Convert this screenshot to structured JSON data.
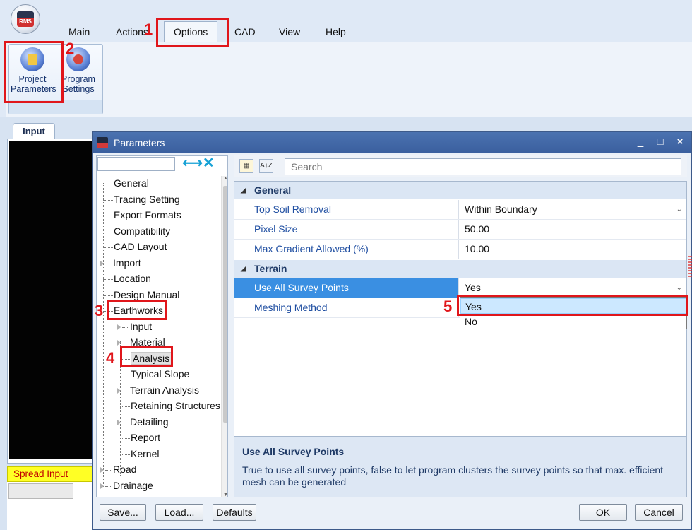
{
  "ribbon": {
    "tabs": [
      "Main",
      "Actions",
      "Options",
      "CAD",
      "View",
      "Help"
    ],
    "active_tab": "Options",
    "buttons": [
      {
        "label": "Project\nParameters",
        "line1": "Project",
        "line2": "Parameters",
        "icon": "project-parameters-icon"
      },
      {
        "label": "Program\nSettings",
        "line1": "Program",
        "line2": "Settings",
        "icon": "program-settings-icon"
      }
    ]
  },
  "workspace": {
    "input_tab": "Input",
    "spread_input": "Spread Input"
  },
  "dialog": {
    "title": "Parameters",
    "window_controls": [
      "_",
      "□",
      "×"
    ],
    "tree": {
      "clear_icon": "⟷✕",
      "items": [
        {
          "label": "General",
          "level": 0
        },
        {
          "label": "Tracing Setting",
          "level": 0
        },
        {
          "label": "Export Formats",
          "level": 0
        },
        {
          "label": "Compatibility",
          "level": 0
        },
        {
          "label": "CAD Layout",
          "level": 0
        },
        {
          "label": "Import",
          "level": 0,
          "expandable": true
        },
        {
          "label": "Location",
          "level": 0
        },
        {
          "label": "Design Manual",
          "level": 0
        },
        {
          "label": "Earthworks",
          "level": 0,
          "expanded": true
        },
        {
          "label": "Input",
          "level": 1,
          "expandable": true
        },
        {
          "label": "Material",
          "level": 1,
          "expandable": true
        },
        {
          "label": "Analysis",
          "level": 1,
          "selected": true
        },
        {
          "label": "Typical Slope",
          "level": 1
        },
        {
          "label": "Terrain Analysis",
          "level": 1,
          "expandable": true
        },
        {
          "label": "Retaining Structures",
          "level": 1
        },
        {
          "label": "Detailing",
          "level": 1,
          "expandable": true
        },
        {
          "label": "Report",
          "level": 1
        },
        {
          "label": "Kernel",
          "level": 1
        },
        {
          "label": "Road",
          "level": 0,
          "expandable": true
        },
        {
          "label": "Drainage",
          "level": 0,
          "expandable": true
        }
      ]
    },
    "toolbar": {
      "categorized_icon": "categorized-view-icon",
      "alpha_icon": "alphabetical-sort-icon",
      "alpha_label": "A↓Z",
      "search_placeholder": "Search"
    },
    "grid": {
      "categories": [
        {
          "name": "General",
          "properties": [
            {
              "name": "Top Soil Removal",
              "value": "Within Boundary",
              "dropdown": true
            },
            {
              "name": "Pixel Size",
              "value": "50.00"
            },
            {
              "name": "Max Gradient Allowed (%)",
              "value": "10.00"
            }
          ]
        },
        {
          "name": "Terrain",
          "properties": [
            {
              "name": "Use All Survey Points",
              "value": "Yes",
              "dropdown": true,
              "selected": true
            },
            {
              "name": "Meshing Method",
              "value": ""
            }
          ]
        }
      ],
      "dropdown_options": [
        "Yes",
        "No"
      ],
      "highlighted_option": "Yes"
    },
    "description": {
      "title": "Use All Survey Points",
      "text": "True to use all survey points, false to let program clusters the survey points so that max. efficient mesh can be generated"
    },
    "buttons": {
      "save": "Save...",
      "load": "Load...",
      "defaults": "Defaults",
      "ok": "OK",
      "cancel": "Cancel"
    }
  },
  "annotations": [
    "1",
    "2",
    "3",
    "4",
    "5"
  ],
  "colors": {
    "annotation_red": "#e0161b",
    "selected_row": "#3a8fe2",
    "spread_input_bg": "#ffff25",
    "titlebar": "#3f64a3"
  }
}
